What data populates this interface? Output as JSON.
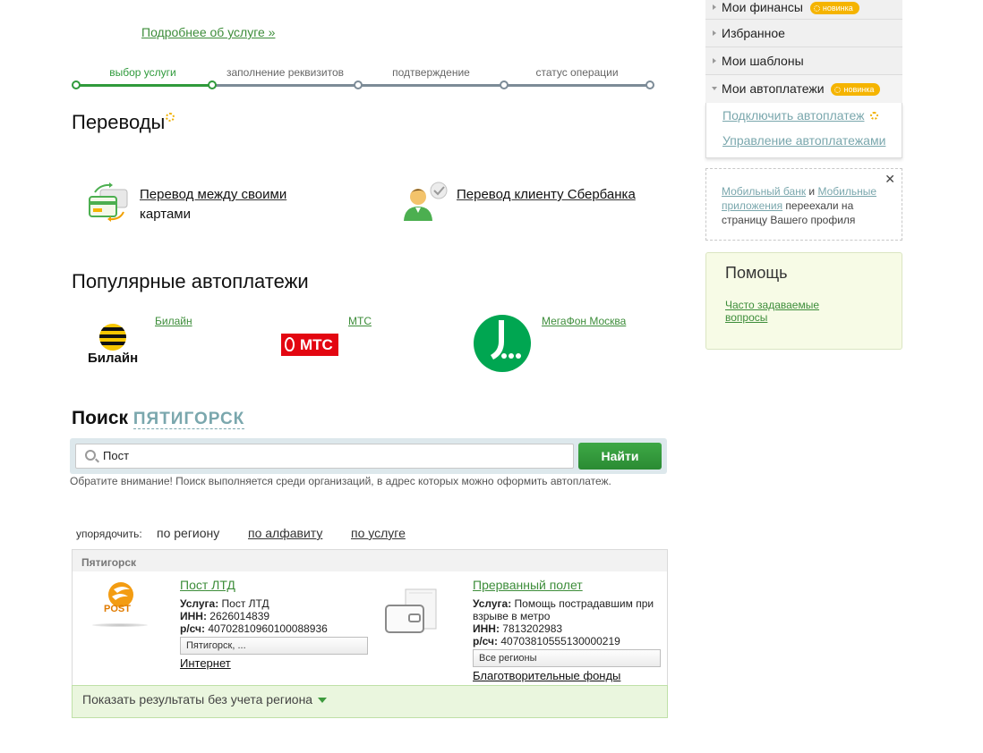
{
  "header": {
    "more_link": "Подробнее об услуге »"
  },
  "steps": [
    "выбор услуги",
    "заполнение реквизитов",
    "подтверждение",
    "статус операции"
  ],
  "transfers": {
    "title": "Переводы",
    "own_cards_line1": "Перевод между своими",
    "own_cards_line2": "картами",
    "to_client": "Перевод клиенту Сбербанка"
  },
  "popular": {
    "title": "Популярные автоплатежи",
    "items": [
      {
        "name": "Билайн",
        "logo_text": "Билайн"
      },
      {
        "name": "МТС",
        "logo_text": "МТС"
      },
      {
        "name": "МегаФон Москва"
      }
    ]
  },
  "search": {
    "title": "Поиск",
    "city": "ПЯТИГОРСК",
    "value": "Пост",
    "button": "Найти",
    "note": "Обратите внимание! Поиск выполняется среди организаций, в адрес которых можно оформить автоплатеж."
  },
  "sort": {
    "label": "упорядочить:",
    "options": [
      "по региону",
      "по алфавиту",
      "по услуге"
    ]
  },
  "results": {
    "region_header": "Пятигорск",
    "items": [
      {
        "name": "Пост ЛТД",
        "logo_text": "POST",
        "service_label": "Услуга:",
        "service": "Пост ЛТД",
        "inn_label": "ИНН:",
        "inn": "2626014839",
        "account_label": "р/сч:",
        "account": "40702810960100088936",
        "region": "Пятигорск, ...",
        "category": "Интернет"
      },
      {
        "name": "Прерванный полет",
        "service_label": "Услуга:",
        "service": "Помощь пострадавшим при взрыве в метро",
        "inn_label": "ИНН:",
        "inn": "7813202983",
        "account_label": "р/сч:",
        "account": "40703810555130000219",
        "region": "Все регионы",
        "category": "Благотворительные фонды"
      }
    ],
    "show_all": "Показать результаты без учета региона"
  },
  "sidebar": {
    "menu": [
      {
        "label": "Мои финансы",
        "badge": "новинка"
      },
      {
        "label": "Избранное"
      },
      {
        "label": "Мои шаблоны"
      },
      {
        "label": "Мои автоплатежи",
        "badge": "новинка"
      }
    ],
    "autopay_links": [
      "Подключить автоплатеж",
      "Управление автоплатежами"
    ],
    "notice": {
      "link1": "Мобильный банк",
      "and": " и ",
      "link2": "Мобильные приложения",
      "text": " переехали на страницу Вашего профиля",
      "close": "✕"
    },
    "help": {
      "title": "Помощь",
      "faq": "Часто задаваемые вопросы"
    }
  },
  "colors": {
    "accent": "#2f9a3b",
    "link": "#3d8d3a",
    "muted_link": "#7aa7ad",
    "badge": "#f5b400"
  }
}
